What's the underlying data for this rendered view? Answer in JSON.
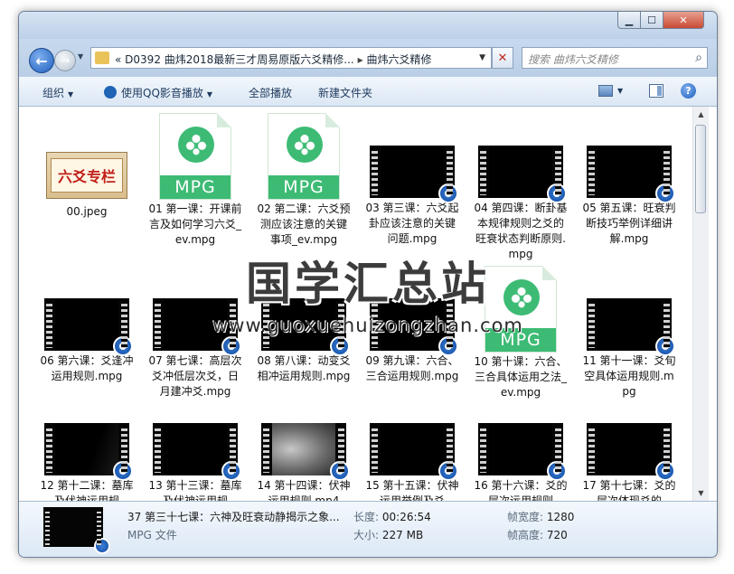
{
  "window": {
    "minimize_glyph": "▁",
    "maximize_glyph": "☐",
    "close_glyph": "✕"
  },
  "address": {
    "chevron": "«",
    "segment1": "D0392 曲炜2018最新三才周易原版六爻精修...",
    "separator": "▸",
    "segment2": "曲炜六爻精修"
  },
  "search": {
    "placeholder": "搜索 曲炜六爻精修"
  },
  "toolbar": {
    "organize": "组织",
    "qq_play": "使用QQ影音播放",
    "play_all": "全部播放",
    "new_folder": "新建文件夹"
  },
  "icons": {
    "back": "arrow-left-icon",
    "forward": "arrow-right-icon",
    "search": "magnifier-icon",
    "help": "help-icon"
  },
  "files": [
    {
      "name": "00.jpeg",
      "kind": "jpg",
      "preview_text": "六爻专栏"
    },
    {
      "name": "01 第一课：开课前言及如何学习六爻_ev.mpg",
      "kind": "mpg"
    },
    {
      "name": "02 第二课：六爻预测应该注意的关键事项_ev.mpg",
      "kind": "mpg"
    },
    {
      "name": "03 第三课：六爻起卦应该注意的关键问题.mpg",
      "kind": "video"
    },
    {
      "name": "04 第四课：断卦基本规律规则之爻的旺衰状态判断原则.mpg",
      "kind": "video"
    },
    {
      "name": "05 第五课：旺衰判断技巧举例详细讲解.mpg",
      "kind": "video"
    },
    {
      "name": "06 第六课：爻逢冲运用规则.mpg",
      "kind": "video"
    },
    {
      "name": "07 第七课：高层次爻冲低层次爻，日月建冲爻.mpg",
      "kind": "video"
    },
    {
      "name": "08 第八课：动变爻相冲运用规则.mpg",
      "kind": "video"
    },
    {
      "name": "09 第九课：六合、三合运用规则.mpg",
      "kind": "video"
    },
    {
      "name": "10 第十课：六合、三合具体运用之法_ev.mpg",
      "kind": "mpg"
    },
    {
      "name": "11 第十一课：爻旬空具体运用规则.mpg",
      "kind": "video"
    },
    {
      "name": "12 第十二课：墓库及伏神运用规",
      "kind": "video"
    },
    {
      "name": "13 第十三课：墓库及伏神运用规",
      "kind": "video"
    },
    {
      "name": "14 第十四课：伏神运用规则.mp4",
      "kind": "video-gray"
    },
    {
      "name": "15 第十五课：伏神运用举例及爻",
      "kind": "video"
    },
    {
      "name": "16 第十六课：爻的层次运用规则",
      "kind": "video"
    },
    {
      "name": "17 第十七课：爻的层次体现爻的",
      "kind": "video"
    }
  ],
  "watermark": {
    "title": "国学汇总站",
    "url": "www.guoxuehuizongzhan.com"
  },
  "details": {
    "filename": "37 第三十七课：六神及旺衰动静揭示之象...",
    "filetype": "MPG 文件",
    "length_label": "长度:",
    "length_value": "00:26:54",
    "size_label": "大小:",
    "size_value": "227 MB",
    "width_label": "帧宽度:",
    "width_value": "1280",
    "height_label": "帧高度:",
    "height_value": "720"
  }
}
